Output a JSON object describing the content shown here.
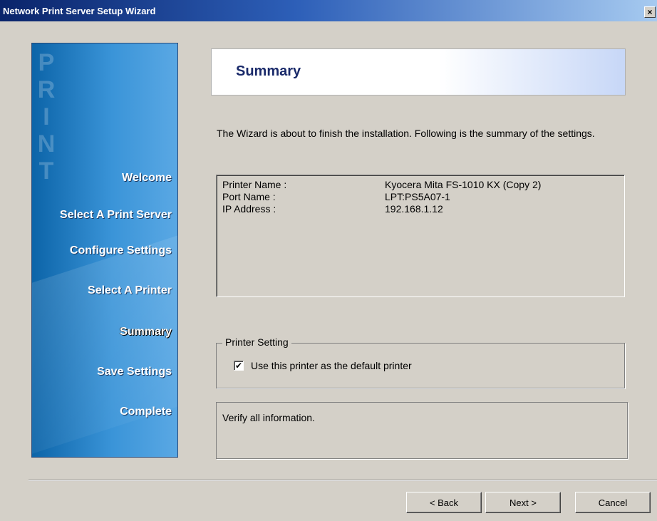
{
  "window": {
    "title": "Network Print Server Setup Wizard",
    "close_glyph": "×"
  },
  "sidebar": {
    "watermark": "PRINT",
    "steps": [
      {
        "label": "Welcome"
      },
      {
        "label": "Select A Print Server"
      },
      {
        "label": "Configure Settings"
      },
      {
        "label": "Select  A  Printer"
      },
      {
        "label": "Summary",
        "active": true
      },
      {
        "label": "Save Settings"
      },
      {
        "label": "Complete"
      }
    ]
  },
  "header": {
    "title": "Summary"
  },
  "intro": "The Wizard is about to finish the installation. Following is the summary of the settings.",
  "summary": {
    "rows": [
      {
        "key": "Printer Name :",
        "value": "Kyocera Mita FS-1010 KX (Copy 2)"
      },
      {
        "key": "Port Name :",
        "value": "LPT:PS5A07-1"
      },
      {
        "key": "IP Address :",
        "value": "192.168.1.12"
      }
    ]
  },
  "printer_setting": {
    "legend": "Printer Setting",
    "checkbox_label": "Use this printer as the default printer",
    "checked": true,
    "check_glyph": "✔"
  },
  "info": {
    "text": "Verify all information."
  },
  "buttons": {
    "back": "< Back",
    "next": "Next >",
    "cancel": "Cancel"
  }
}
